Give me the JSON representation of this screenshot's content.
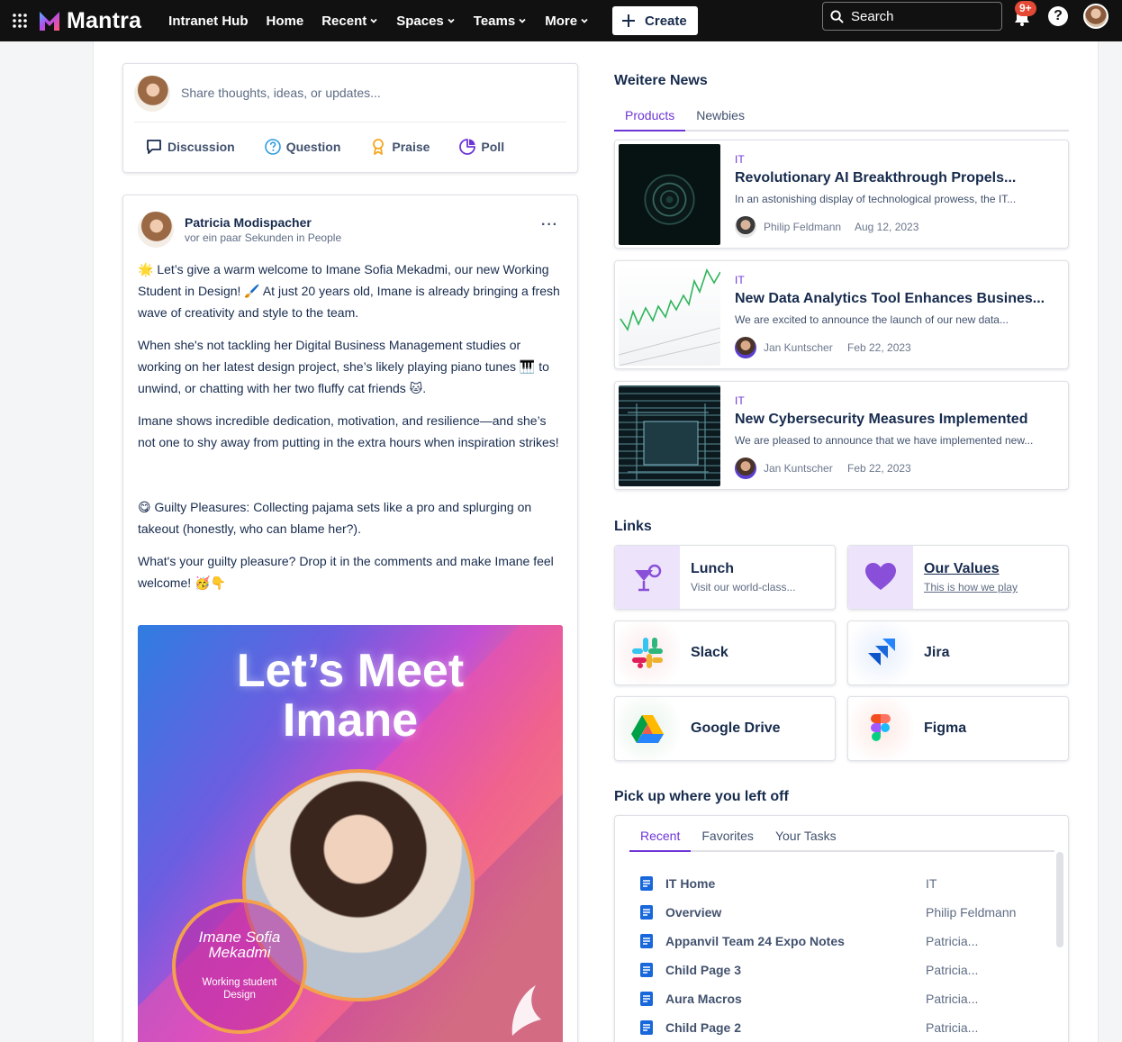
{
  "topnav": {
    "brand": "Mantra",
    "items": [
      {
        "label": "Intranet Hub",
        "dropdown": false
      },
      {
        "label": "Home",
        "dropdown": false
      },
      {
        "label": "Recent",
        "dropdown": true
      },
      {
        "label": "Spaces",
        "dropdown": true
      },
      {
        "label": "Teams",
        "dropdown": true
      },
      {
        "label": "More",
        "dropdown": true
      }
    ],
    "create_label": "Create",
    "search_label": "Search",
    "notification_badge": "9+",
    "help_label": "?"
  },
  "composer": {
    "placeholder": "Share thoughts, ideas, or updates...",
    "actions": [
      {
        "label": "Discussion",
        "icon": "speech-bubble-icon"
      },
      {
        "label": "Question",
        "icon": "question-circle-icon"
      },
      {
        "label": "Praise",
        "icon": "award-ribbon-icon"
      },
      {
        "label": "Poll",
        "icon": "pie-chart-icon"
      }
    ]
  },
  "post": {
    "author": "Patricia Modispacher",
    "meta": "vor ein paar Sekunden in People",
    "paragraphs": [
      "🌟 Let’s give a warm welcome to Imane Sofia Mekadmi, our new Working Student in Design! 🖌️ At just 20 years old, Imane is already bringing a fresh wave of creativity and style to the team.",
      "When she's not tackling her Digital Business Management studies or working on her latest design project, she’s likely playing piano tunes 🎹 to unwind, or chatting with her two fluffy cat friends 🐱.",
      "Imane shows incredible dedication, motivation, and resilience—and she’s not one to shy away from putting in the extra hours when inspiration strikes!",
      "",
      "😋 Guilty Pleasures: Collecting pajama sets like a pro and splurging on takeout (honestly, who can blame her?).",
      "What's your guilty pleasure? Drop it in the comments and make Imane feel welcome! 🥳👇"
    ],
    "image": {
      "headline_line1": "Let’s Meet",
      "headline_line2": "Imane",
      "name_line1": "Imane Sofia",
      "name_line2": "Mekadmi",
      "role_line1": "Working student",
      "role_line2": "Design"
    }
  },
  "news": {
    "heading": "Weitere News",
    "tabs": [
      "Products",
      "Newbies"
    ],
    "active_tab": "Products",
    "items": [
      {
        "category": "IT",
        "title": "Revolutionary AI Breakthrough Propels...",
        "excerpt": "In an astonishing display of technological prowess, the IT...",
        "author": "Philip Feldmann",
        "date": "Aug 12, 2023",
        "thumb": "rings"
      },
      {
        "category": "IT",
        "title": "New Data Analytics Tool Enhances Busines...",
        "excerpt": "We are excited to announce the launch of our new data...",
        "author": "Jan Kuntscher",
        "date": "Feb 22, 2023",
        "thumb": "chart"
      },
      {
        "category": "IT",
        "title": "New Cybersecurity Measures Implemented",
        "excerpt": "We are pleased to announce that we have implemented new...",
        "author": "Jan Kuntscher",
        "date": "Feb 22, 2023",
        "thumb": "chip"
      }
    ]
  },
  "links": {
    "heading": "Links",
    "items": [
      {
        "label": "Lunch",
        "subtitle": "Visit our world-class...",
        "icon": "cocktail-glass-icon"
      },
      {
        "label": "Our Values",
        "subtitle": "This is how we play",
        "icon": "heart-icon"
      },
      {
        "label": "Slack",
        "subtitle": "",
        "icon": "slack-icon"
      },
      {
        "label": "Jira",
        "subtitle": "",
        "icon": "jira-icon"
      },
      {
        "label": "Google Drive",
        "subtitle": "",
        "icon": "google-drive-icon"
      },
      {
        "label": "Figma",
        "subtitle": "",
        "icon": "figma-icon"
      }
    ]
  },
  "pickup": {
    "heading": "Pick up where you left off",
    "tabs": [
      "Recent",
      "Favorites",
      "Your Tasks"
    ],
    "active_tab": "Recent",
    "rows": [
      {
        "name": "IT Home",
        "space": "IT"
      },
      {
        "name": "Overview",
        "space": "Philip Feldmann"
      },
      {
        "name": "Appanvil Team 24 Expo Notes",
        "space": "Patricia..."
      },
      {
        "name": "Child Page 3",
        "space": "Patricia..."
      },
      {
        "name": "Aura Macros",
        "space": "Patricia..."
      },
      {
        "name": "Child Page 2",
        "space": "Patricia..."
      }
    ]
  },
  "colors": {
    "accent": "#6e35d6",
    "topbar": "#111111",
    "badge": "#e34935"
  }
}
